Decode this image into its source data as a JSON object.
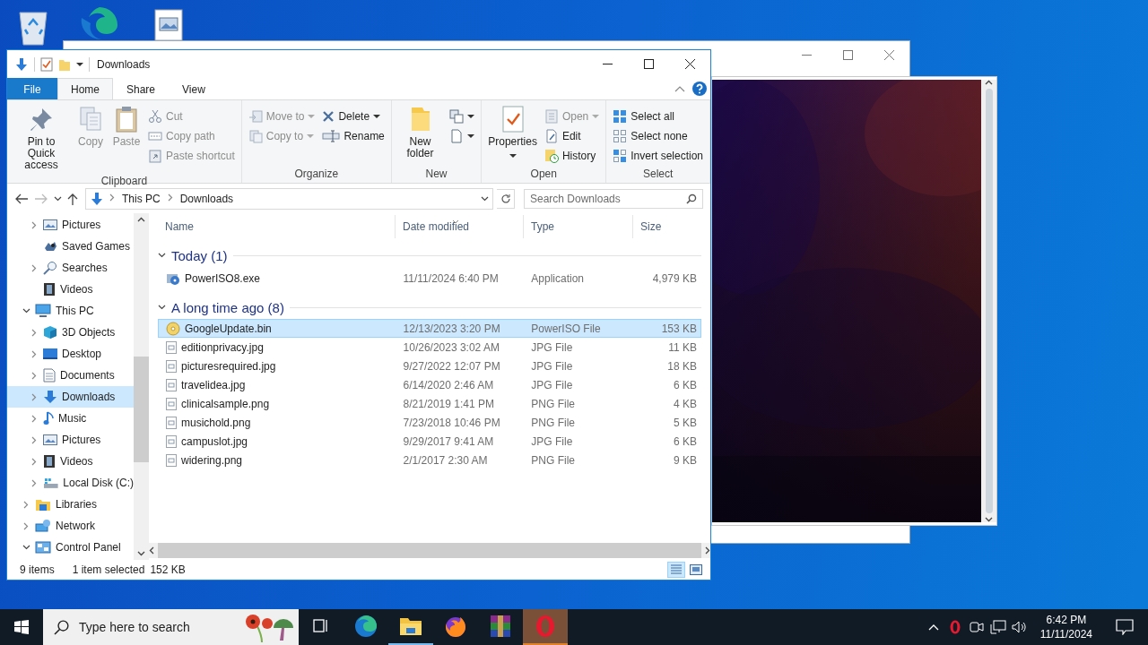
{
  "window": {
    "title": "Downloads"
  },
  "file_menu": {
    "label": "File"
  },
  "ribbon_tabs": [
    {
      "label": "Home",
      "selected": true
    },
    {
      "label": "Share",
      "selected": false
    },
    {
      "label": "View",
      "selected": false
    }
  ],
  "ribbon_groups": [
    {
      "label": "Clipboard",
      "columns": [
        {
          "kind": "large",
          "buttons": [
            {
              "label": "Pin to Quick access",
              "disabled": false
            }
          ]
        },
        {
          "kind": "large",
          "buttons": [
            {
              "label": "Copy",
              "disabled": true
            }
          ]
        },
        {
          "kind": "large",
          "buttons": [
            {
              "label": "Paste",
              "disabled": true
            }
          ]
        },
        {
          "kind": "small",
          "buttons": [
            {
              "label": "Cut",
              "disabled": true
            },
            {
              "label": "Copy path",
              "disabled": true
            },
            {
              "label": "Paste shortcut",
              "disabled": true
            }
          ]
        }
      ]
    },
    {
      "label": "Organize",
      "columns": [
        {
          "kind": "small",
          "buttons": [
            {
              "label": "Move to",
              "disabled": true,
              "dropdown": true
            },
            {
              "label": "Copy to",
              "disabled": true,
              "dropdown": true
            }
          ]
        },
        {
          "kind": "small",
          "buttons": [
            {
              "label": "Delete",
              "disabled": false,
              "dropdown": true
            },
            {
              "label": "Rename",
              "disabled": false
            }
          ]
        }
      ]
    },
    {
      "label": "New",
      "columns": [
        {
          "kind": "large",
          "buttons": [
            {
              "label": "New folder",
              "disabled": false
            }
          ]
        },
        {
          "kind": "small",
          "buttons": [
            {
              "disabled": false,
              "dropdown": true
            },
            {
              "disabled": false,
              "dropdown": true
            }
          ]
        }
      ]
    },
    {
      "label": "Open",
      "columns": [
        {
          "kind": "large",
          "buttons": [
            {
              "label": "Properties",
              "disabled": false,
              "dropdown": true
            }
          ]
        },
        {
          "kind": "small",
          "buttons": [
            {
              "label": "Open",
              "disabled": true,
              "dropdown": true
            },
            {
              "label": "Edit",
              "disabled": false
            },
            {
              "label": "History",
              "disabled": false
            }
          ]
        }
      ]
    },
    {
      "label": "Select",
      "columns": [
        {
          "kind": "small",
          "buttons": [
            {
              "label": "Select all",
              "disabled": false
            },
            {
              "label": "Select none",
              "disabled": false
            },
            {
              "label": "Invert selection",
              "disabled": false
            }
          ]
        }
      ]
    }
  ],
  "address": {
    "path": [
      "This PC",
      "Downloads"
    ]
  },
  "search": {
    "placeholder": "Search Downloads"
  },
  "nav_tree": [
    {
      "children": [
        {
          "label": "Pictures",
          "expandable": true,
          "expanded": false,
          "selected": false
        },
        {
          "label": "Saved Games",
          "expandable": false,
          "selected": false
        },
        {
          "label": "Searches",
          "expandable": true,
          "expanded": false,
          "selected": false
        },
        {
          "label": "Videos",
          "expandable": false,
          "selected": false
        }
      ]
    },
    {
      "label": "This PC",
      "expandable": true,
      "expanded": true,
      "selected": false,
      "children": [
        {
          "label": "3D Objects",
          "expandable": true,
          "expanded": false,
          "selected": false
        },
        {
          "label": "Desktop",
          "expandable": true,
          "expanded": false,
          "selected": false
        },
        {
          "label": "Documents",
          "expandable": true,
          "expanded": false,
          "selected": false
        },
        {
          "label": "Downloads",
          "expandable": true,
          "expanded": false,
          "selected": true
        },
        {
          "label": "Music",
          "expandable": true,
          "expanded": false,
          "selected": false
        },
        {
          "label": "Pictures",
          "expandable": true,
          "expanded": false,
          "selected": false
        },
        {
          "label": "Videos",
          "expandable": true,
          "expanded": false,
          "selected": false
        },
        {
          "label": "Local Disk (C:)",
          "expandable": true,
          "expanded": false,
          "selected": false
        }
      ]
    },
    {
      "label": "Libraries",
      "expandable": true,
      "expanded": false,
      "selected": false
    },
    {
      "label": "Network",
      "expandable": true,
      "expanded": false,
      "selected": false
    },
    {
      "label": "Control Panel",
      "expandable": true,
      "expanded": true,
      "selected": false
    }
  ],
  "table": {
    "columns": [
      {
        "label": "Name",
        "sorted": false
      },
      {
        "label": "Date modified",
        "sorted": true
      },
      {
        "label": "Type",
        "sorted": false
      },
      {
        "label": "Size",
        "sorted": false
      }
    ],
    "groups": [
      {
        "label": "Today (1)",
        "expanded": true,
        "rows": [
          {
            "name": "PowerISO8.exe",
            "date": "11/11/2024 6:40 PM",
            "type": "Application",
            "size": "4,979 KB",
            "selected": false
          }
        ]
      },
      {
        "label": "A long time ago (8)",
        "expanded": true,
        "rows": [
          {
            "name": "GoogleUpdate.bin",
            "date": "12/13/2023 3:20 PM",
            "type": "PowerISO File",
            "size": "153 KB",
            "selected": true
          },
          {
            "name": "editionprivacy.jpg",
            "date": "10/26/2023 3:02 AM",
            "type": "JPG File",
            "size": "11 KB",
            "selected": false
          },
          {
            "name": "picturesrequired.jpg",
            "date": "9/27/2022 12:07 PM",
            "type": "JPG File",
            "size": "18 KB",
            "selected": false
          },
          {
            "name": "travelidea.jpg",
            "date": "6/14/2020 2:46 AM",
            "type": "JPG File",
            "size": "6 KB",
            "selected": false
          },
          {
            "name": "clinicalsample.png",
            "date": "8/21/2019 1:41 PM",
            "type": "PNG File",
            "size": "4 KB",
            "selected": false
          },
          {
            "name": "musichold.png",
            "date": "7/23/2018 10:46 PM",
            "type": "PNG File",
            "size": "5 KB",
            "selected": false
          },
          {
            "name": "campuslot.jpg",
            "date": "9/29/2017 9:41 AM",
            "type": "JPG File",
            "size": "6 KB",
            "selected": false
          },
          {
            "name": "widering.png",
            "date": "2/1/2017 2:30 AM",
            "type": "PNG File",
            "size": "9 KB",
            "selected": false
          }
        ]
      }
    ]
  },
  "status_bar": {
    "item_count": "9 items",
    "selection": "1 item selected",
    "selection_size": "152 KB"
  },
  "view_buttons": [
    {
      "selected": true
    },
    {
      "selected": false
    }
  ],
  "taskbar": {
    "search": {
      "placeholder": "Type here to search"
    },
    "apps": [
      {
        "running": false,
        "flashing": false
      },
      {
        "running": true,
        "flashing": false
      },
      {
        "running": false,
        "flashing": false
      },
      {
        "running": false,
        "flashing": false
      },
      {
        "running": true,
        "flashing": true
      }
    ],
    "clock": {
      "time": "6:42 PM",
      "date": "11/11/2024"
    }
  }
}
